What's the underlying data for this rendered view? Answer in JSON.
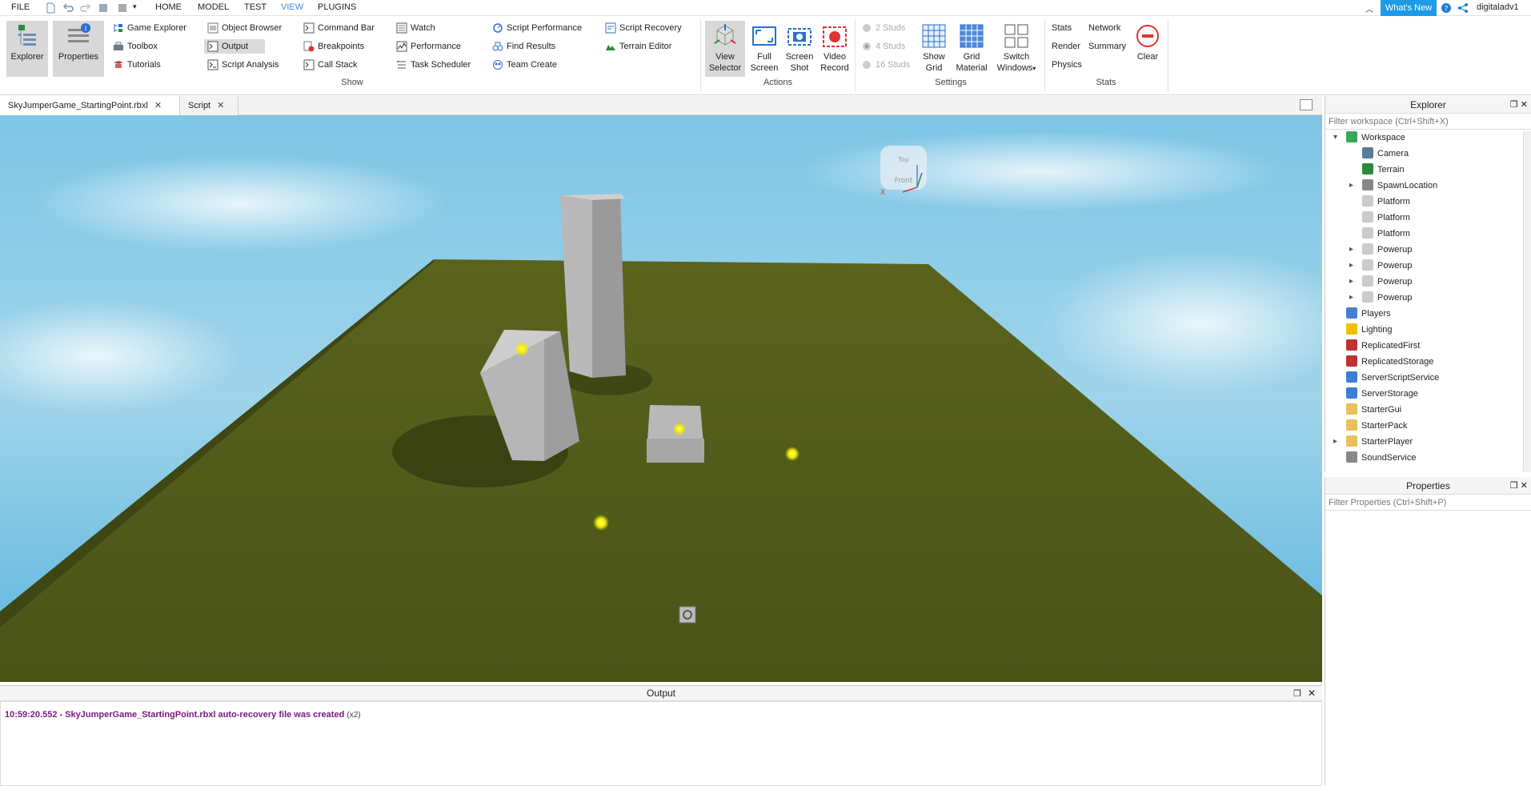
{
  "menu": {
    "file": "FILE",
    "tabs": [
      "HOME",
      "MODEL",
      "TEST",
      "VIEW",
      "PLUGINS"
    ],
    "whats_new": "What's New",
    "username": "digitaladv1"
  },
  "ribbon": {
    "explorer": "Explorer",
    "properties": "Properties",
    "show": {
      "label": "Show",
      "col1": [
        "Game Explorer",
        "Toolbox",
        "Tutorials"
      ],
      "col2": [
        "Object Browser",
        "Output",
        "Script Analysis"
      ],
      "col3": [
        "Command Bar",
        "Breakpoints",
        "Call Stack"
      ],
      "col4": [
        "Watch",
        "Performance",
        "Task Scheduler"
      ],
      "col5": [
        "Script Performance",
        "Find Results",
        "Team Create"
      ],
      "col6": [
        "Script Recovery",
        "Terrain Editor"
      ]
    },
    "actions": {
      "label": "Actions",
      "view_selector": [
        "View",
        "Selector"
      ],
      "full_screen": [
        "Full",
        "Screen"
      ],
      "screen_shot": [
        "Screen",
        "Shot"
      ],
      "video_record": [
        "Video",
        "Record"
      ]
    },
    "settings": {
      "label": "Settings",
      "studs": [
        "2 Studs",
        "4 Studs",
        "16 Studs"
      ],
      "show_grid": [
        "Show",
        "Grid"
      ],
      "grid_material": [
        "Grid",
        "Material"
      ],
      "switch_windows": [
        "Switch",
        "Windows"
      ]
    },
    "stats": {
      "label": "Stats",
      "items": [
        "Stats",
        "Network",
        "Render",
        "Summary",
        "Physics"
      ],
      "clear": "Clear"
    }
  },
  "doc_tabs": [
    "SkyJumperGame_StartingPoint.rbxl",
    "Script"
  ],
  "output": {
    "title": "Output",
    "message": "10:59:20.552 - SkyJumperGame_StartingPoint.rbxl auto-recovery file was created",
    "count": "(x2)"
  },
  "explorer": {
    "title": "Explorer",
    "filter_placeholder": "Filter workspace (Ctrl+Shift+X)",
    "nodes": [
      "Workspace",
      "Camera",
      "Terrain",
      "SpawnLocation",
      "Platform",
      "Platform",
      "Platform",
      "Powerup",
      "Powerup",
      "Powerup",
      "Powerup",
      "Players",
      "Lighting",
      "ReplicatedFirst",
      "ReplicatedStorage",
      "ServerScriptService",
      "ServerStorage",
      "StarterGui",
      "StarterPack",
      "StarterPlayer",
      "SoundService"
    ]
  },
  "properties": {
    "title": "Properties",
    "filter_placeholder": "Filter Properties (Ctrl+Shift+P)"
  },
  "viewcube": {
    "top": "Top",
    "front": "Front",
    "x_axis": "X"
  },
  "colors": {
    "accent": "#1c9be8",
    "sky_top": "#5fb8de",
    "ground": "#4f5a18",
    "output_text": "#7a1a82"
  }
}
